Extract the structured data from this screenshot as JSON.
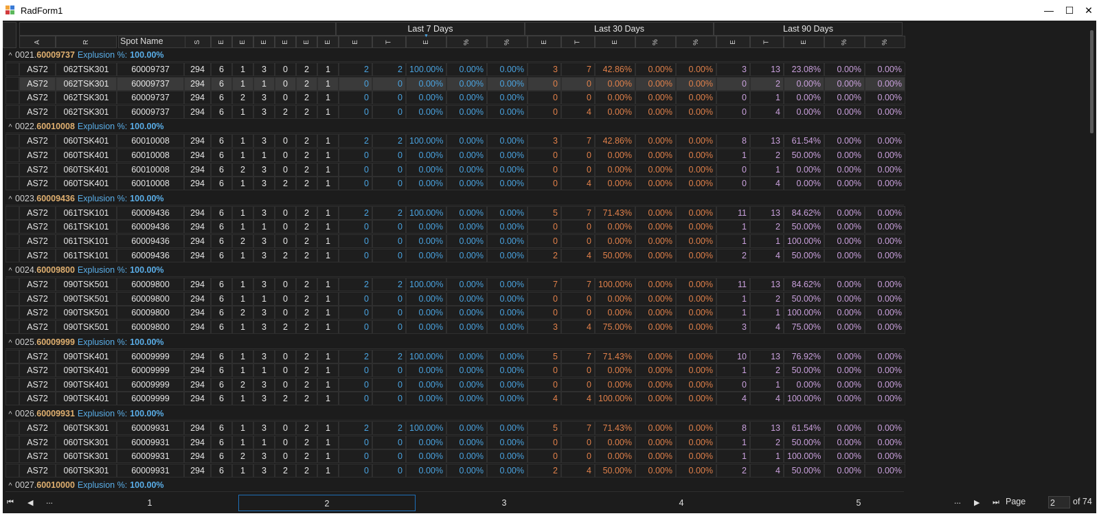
{
  "window": {
    "title": "RadForm1",
    "minimize": "—",
    "maximize": "☐",
    "close": "✕"
  },
  "header": {
    "bands": [
      "Last 7 Days",
      "Last 30 Days",
      "Last 90 Days"
    ],
    "fixed_cols": [
      "A",
      "R",
      "S",
      "E",
      "E",
      "E",
      "E",
      "E",
      "E"
    ],
    "spot_name": "Spot Name",
    "period_cols": [
      "E",
      "T",
      "E",
      "%",
      "%"
    ],
    "sort_indicator": "▼"
  },
  "groups": [
    {
      "num": "0021.",
      "id": "60009737",
      "label": "Explusion %:",
      "pct": "100.00%",
      "rows": [
        [
          "AS72",
          "062TSK301",
          "60009737",
          "294",
          "6",
          "1",
          "3",
          "0",
          "2",
          "1",
          "2",
          "2",
          "100.00%",
          "0.00%",
          "0.00%",
          "3",
          "7",
          "42.86%",
          "0.00%",
          "0.00%",
          "3",
          "13",
          "23.08%",
          "0.00%",
          "0.00%"
        ],
        [
          "AS72",
          "062TSK301",
          "60009737",
          "294",
          "6",
          "1",
          "1",
          "0",
          "2",
          "1",
          "0",
          "0",
          "0.00%",
          "0.00%",
          "0.00%",
          "0",
          "0",
          "0.00%",
          "0.00%",
          "0.00%",
          "0",
          "2",
          "0.00%",
          "0.00%",
          "0.00%"
        ],
        [
          "AS72",
          "062TSK301",
          "60009737",
          "294",
          "6",
          "2",
          "3",
          "0",
          "2",
          "1",
          "0",
          "0",
          "0.00%",
          "0.00%",
          "0.00%",
          "0",
          "0",
          "0.00%",
          "0.00%",
          "0.00%",
          "0",
          "1",
          "0.00%",
          "0.00%",
          "0.00%"
        ],
        [
          "AS72",
          "062TSK301",
          "60009737",
          "294",
          "6",
          "1",
          "3",
          "2",
          "2",
          "1",
          "0",
          "0",
          "0.00%",
          "0.00%",
          "0.00%",
          "0",
          "4",
          "0.00%",
          "0.00%",
          "0.00%",
          "0",
          "4",
          "0.00%",
          "0.00%",
          "0.00%"
        ]
      ]
    },
    {
      "num": "0022.",
      "id": "60010008",
      "label": "Explusion %:",
      "pct": "100.00%",
      "rows": [
        [
          "AS72",
          "060TSK401",
          "60010008",
          "294",
          "6",
          "1",
          "3",
          "0",
          "2",
          "1",
          "2",
          "2",
          "100.00%",
          "0.00%",
          "0.00%",
          "3",
          "7",
          "42.86%",
          "0.00%",
          "0.00%",
          "8",
          "13",
          "61.54%",
          "0.00%",
          "0.00%"
        ],
        [
          "AS72",
          "060TSK401",
          "60010008",
          "294",
          "6",
          "1",
          "1",
          "0",
          "2",
          "1",
          "0",
          "0",
          "0.00%",
          "0.00%",
          "0.00%",
          "0",
          "0",
          "0.00%",
          "0.00%",
          "0.00%",
          "1",
          "2",
          "50.00%",
          "0.00%",
          "0.00%"
        ],
        [
          "AS72",
          "060TSK401",
          "60010008",
          "294",
          "6",
          "2",
          "3",
          "0",
          "2",
          "1",
          "0",
          "0",
          "0.00%",
          "0.00%",
          "0.00%",
          "0",
          "0",
          "0.00%",
          "0.00%",
          "0.00%",
          "0",
          "1",
          "0.00%",
          "0.00%",
          "0.00%"
        ],
        [
          "AS72",
          "060TSK401",
          "60010008",
          "294",
          "6",
          "1",
          "3",
          "2",
          "2",
          "1",
          "0",
          "0",
          "0.00%",
          "0.00%",
          "0.00%",
          "0",
          "4",
          "0.00%",
          "0.00%",
          "0.00%",
          "0",
          "4",
          "0.00%",
          "0.00%",
          "0.00%"
        ]
      ]
    },
    {
      "num": "0023.",
      "id": "60009436",
      "label": "Explusion %:",
      "pct": "100.00%",
      "rows": [
        [
          "AS72",
          "061TSK101",
          "60009436",
          "294",
          "6",
          "1",
          "3",
          "0",
          "2",
          "1",
          "2",
          "2",
          "100.00%",
          "0.00%",
          "0.00%",
          "5",
          "7",
          "71.43%",
          "0.00%",
          "0.00%",
          "11",
          "13",
          "84.62%",
          "0.00%",
          "0.00%"
        ],
        [
          "AS72",
          "061TSK101",
          "60009436",
          "294",
          "6",
          "1",
          "1",
          "0",
          "2",
          "1",
          "0",
          "0",
          "0.00%",
          "0.00%",
          "0.00%",
          "0",
          "0",
          "0.00%",
          "0.00%",
          "0.00%",
          "1",
          "2",
          "50.00%",
          "0.00%",
          "0.00%"
        ],
        [
          "AS72",
          "061TSK101",
          "60009436",
          "294",
          "6",
          "2",
          "3",
          "0",
          "2",
          "1",
          "0",
          "0",
          "0.00%",
          "0.00%",
          "0.00%",
          "0",
          "0",
          "0.00%",
          "0.00%",
          "0.00%",
          "1",
          "1",
          "100.00%",
          "0.00%",
          "0.00%"
        ],
        [
          "AS72",
          "061TSK101",
          "60009436",
          "294",
          "6",
          "1",
          "3",
          "2",
          "2",
          "1",
          "0",
          "0",
          "0.00%",
          "0.00%",
          "0.00%",
          "2",
          "4",
          "50.00%",
          "0.00%",
          "0.00%",
          "2",
          "4",
          "50.00%",
          "0.00%",
          "0.00%"
        ]
      ]
    },
    {
      "num": "0024.",
      "id": "60009800",
      "label": "Explusion %:",
      "pct": "100.00%",
      "rows": [
        [
          "AS72",
          "090TSK501",
          "60009800",
          "294",
          "6",
          "1",
          "3",
          "0",
          "2",
          "1",
          "2",
          "2",
          "100.00%",
          "0.00%",
          "0.00%",
          "7",
          "7",
          "100.00%",
          "0.00%",
          "0.00%",
          "11",
          "13",
          "84.62%",
          "0.00%",
          "0.00%"
        ],
        [
          "AS72",
          "090TSK501",
          "60009800",
          "294",
          "6",
          "1",
          "1",
          "0",
          "2",
          "1",
          "0",
          "0",
          "0.00%",
          "0.00%",
          "0.00%",
          "0",
          "0",
          "0.00%",
          "0.00%",
          "0.00%",
          "1",
          "2",
          "50.00%",
          "0.00%",
          "0.00%"
        ],
        [
          "AS72",
          "090TSK501",
          "60009800",
          "294",
          "6",
          "2",
          "3",
          "0",
          "2",
          "1",
          "0",
          "0",
          "0.00%",
          "0.00%",
          "0.00%",
          "0",
          "0",
          "0.00%",
          "0.00%",
          "0.00%",
          "1",
          "1",
          "100.00%",
          "0.00%",
          "0.00%"
        ],
        [
          "AS72",
          "090TSK501",
          "60009800",
          "294",
          "6",
          "1",
          "3",
          "2",
          "2",
          "1",
          "0",
          "0",
          "0.00%",
          "0.00%",
          "0.00%",
          "3",
          "4",
          "75.00%",
          "0.00%",
          "0.00%",
          "3",
          "4",
          "75.00%",
          "0.00%",
          "0.00%"
        ]
      ]
    },
    {
      "num": "0025.",
      "id": "60009999",
      "label": "Explusion %:",
      "pct": "100.00%",
      "rows": [
        [
          "AS72",
          "090TSK401",
          "60009999",
          "294",
          "6",
          "1",
          "3",
          "0",
          "2",
          "1",
          "2",
          "2",
          "100.00%",
          "0.00%",
          "0.00%",
          "5",
          "7",
          "71.43%",
          "0.00%",
          "0.00%",
          "10",
          "13",
          "76.92%",
          "0.00%",
          "0.00%"
        ],
        [
          "AS72",
          "090TSK401",
          "60009999",
          "294",
          "6",
          "1",
          "1",
          "0",
          "2",
          "1",
          "0",
          "0",
          "0.00%",
          "0.00%",
          "0.00%",
          "0",
          "0",
          "0.00%",
          "0.00%",
          "0.00%",
          "1",
          "2",
          "50.00%",
          "0.00%",
          "0.00%"
        ],
        [
          "AS72",
          "090TSK401",
          "60009999",
          "294",
          "6",
          "2",
          "3",
          "0",
          "2",
          "1",
          "0",
          "0",
          "0.00%",
          "0.00%",
          "0.00%",
          "0",
          "0",
          "0.00%",
          "0.00%",
          "0.00%",
          "0",
          "1",
          "0.00%",
          "0.00%",
          "0.00%"
        ],
        [
          "AS72",
          "090TSK401",
          "60009999",
          "294",
          "6",
          "1",
          "3",
          "2",
          "2",
          "1",
          "0",
          "0",
          "0.00%",
          "0.00%",
          "0.00%",
          "4",
          "4",
          "100.00%",
          "0.00%",
          "0.00%",
          "4",
          "4",
          "100.00%",
          "0.00%",
          "0.00%"
        ]
      ]
    },
    {
      "num": "0026.",
      "id": "60009931",
      "label": "Explusion %:",
      "pct": "100.00%",
      "rows": [
        [
          "AS72",
          "060TSK301",
          "60009931",
          "294",
          "6",
          "1",
          "3",
          "0",
          "2",
          "1",
          "2",
          "2",
          "100.00%",
          "0.00%",
          "0.00%",
          "5",
          "7",
          "71.43%",
          "0.00%",
          "0.00%",
          "8",
          "13",
          "61.54%",
          "0.00%",
          "0.00%"
        ],
        [
          "AS72",
          "060TSK301",
          "60009931",
          "294",
          "6",
          "1",
          "1",
          "0",
          "2",
          "1",
          "0",
          "0",
          "0.00%",
          "0.00%",
          "0.00%",
          "0",
          "0",
          "0.00%",
          "0.00%",
          "0.00%",
          "1",
          "2",
          "50.00%",
          "0.00%",
          "0.00%"
        ],
        [
          "AS72",
          "060TSK301",
          "60009931",
          "294",
          "6",
          "2",
          "3",
          "0",
          "2",
          "1",
          "0",
          "0",
          "0.00%",
          "0.00%",
          "0.00%",
          "0",
          "0",
          "0.00%",
          "0.00%",
          "0.00%",
          "1",
          "1",
          "100.00%",
          "0.00%",
          "0.00%"
        ],
        [
          "AS72",
          "060TSK301",
          "60009931",
          "294",
          "6",
          "1",
          "3",
          "2",
          "2",
          "1",
          "0",
          "0",
          "0.00%",
          "0.00%",
          "0.00%",
          "2",
          "4",
          "50.00%",
          "0.00%",
          "0.00%",
          "2",
          "4",
          "50.00%",
          "0.00%",
          "0.00%"
        ]
      ]
    },
    {
      "num": "0027.",
      "id": "60010000",
      "label": "Explusion %:",
      "pct": "100.00%",
      "rows": []
    }
  ],
  "selected_row": {
    "group": 0,
    "row": 1
  },
  "pager": {
    "first_icon": "⏮",
    "prev_icon": "◀",
    "ellipsis_left": "...",
    "pages": [
      "1",
      "2",
      "3",
      "4",
      "5"
    ],
    "current": "2",
    "ellipsis_right": "...",
    "next_icon": "▶",
    "last_icon": "⏭",
    "page_label": "Page",
    "page_value": "2",
    "of_label": "of 74"
  },
  "colors": {
    "background": "#1c1c1c",
    "blue": "#4aa3e0",
    "orange": "#e0804a",
    "purple": "#c9a0dc",
    "group_id": "#e0b070"
  }
}
